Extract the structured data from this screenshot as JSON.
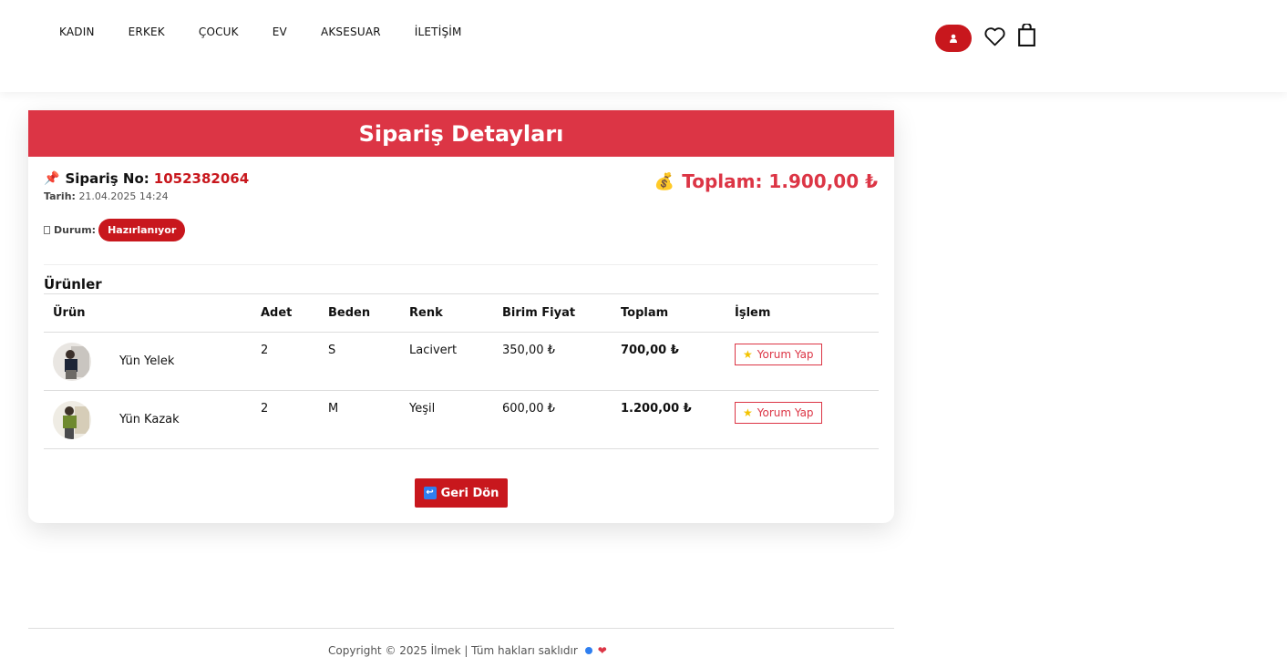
{
  "nav": {
    "items": [
      "KADIN",
      "ERKEK",
      "ÇOCUK",
      "EV",
      "AKSESUAR",
      "İLETİŞİM"
    ]
  },
  "header": {
    "title": "Sipariş Detayları"
  },
  "order": {
    "no_label": "Sipariş No:",
    "no_value": "1052382064",
    "date_label": "Tarih:",
    "date_value": "21.04.2025 14:24",
    "status_label": "Durum:",
    "status_value": "Hazırlanıyor",
    "total_text": "Toplam: 1.900,00 ₺"
  },
  "products": {
    "heading": "Ürünler",
    "columns": [
      "Ürün",
      "Adet",
      "Beden",
      "Renk",
      "Birim Fiyat",
      "Toplam",
      "İşlem"
    ],
    "rows": [
      {
        "name": "Yün Yelek",
        "qty": "2",
        "size": "S",
        "color": "Lacivert",
        "unit": "350,00 ₺",
        "total": "700,00 ₺",
        "action": "Yorum Yap"
      },
      {
        "name": "Yün Kazak",
        "qty": "2",
        "size": "M",
        "color": "Yeşil",
        "unit": "600,00 ₺",
        "total": "1.200,00 ₺",
        "action": "Yorum Yap"
      }
    ]
  },
  "back_button": "Geri Dön",
  "footer": {
    "copyright": "Copyright © 2025 İlmek | Tüm hakları saklıdır"
  },
  "colors": {
    "accent": "#dc3545",
    "button": "#c8171d"
  },
  "icons": [
    "user-icon",
    "heart-icon",
    "shopping-bag-icon",
    "pin-icon",
    "money-bag-icon",
    "star-icon",
    "return-icon"
  ]
}
